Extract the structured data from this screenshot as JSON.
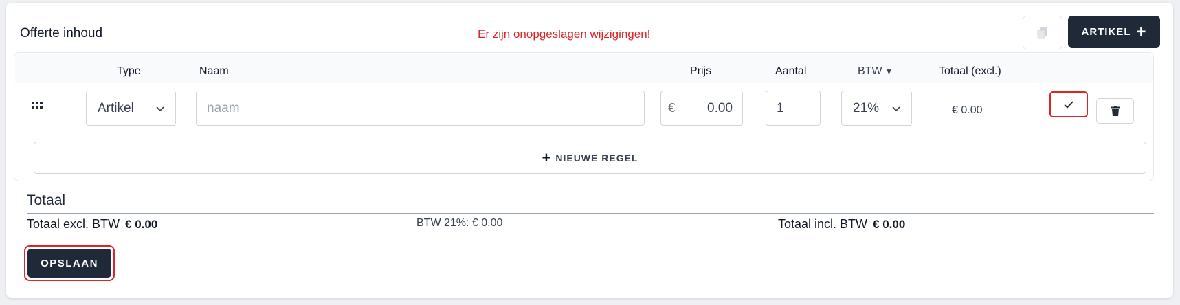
{
  "header": {
    "title": "Offerte inhoud",
    "unsaved_notice": "Er zijn onopgeslagen wijzigingen!",
    "add_article_label": "ARTIKEL"
  },
  "table": {
    "columns": {
      "type": "Type",
      "name": "Naam",
      "price": "Prijs",
      "quantity": "Aantal",
      "vat": "BTW",
      "total": "Totaal (excl.)"
    },
    "row": {
      "type_value": "Artikel",
      "name_placeholder": "naam",
      "currency": "€",
      "price_value": "0.00",
      "quantity_value": "1",
      "vat_value": "21%",
      "total_value": "€ 0.00"
    },
    "new_row_label": "NIEUWE REGEL"
  },
  "totals": {
    "title": "Totaal",
    "excl_label": "Totaal excl. BTW",
    "excl_value": "€ 0.00",
    "vat_line": "BTW 21%: € 0.00",
    "incl_label": "Totaal incl. BTW",
    "incl_value": "€ 0.00"
  },
  "save_label": "OPSLAAN",
  "colors": {
    "primary_dark": "#1f2937",
    "danger": "#dc2626"
  }
}
